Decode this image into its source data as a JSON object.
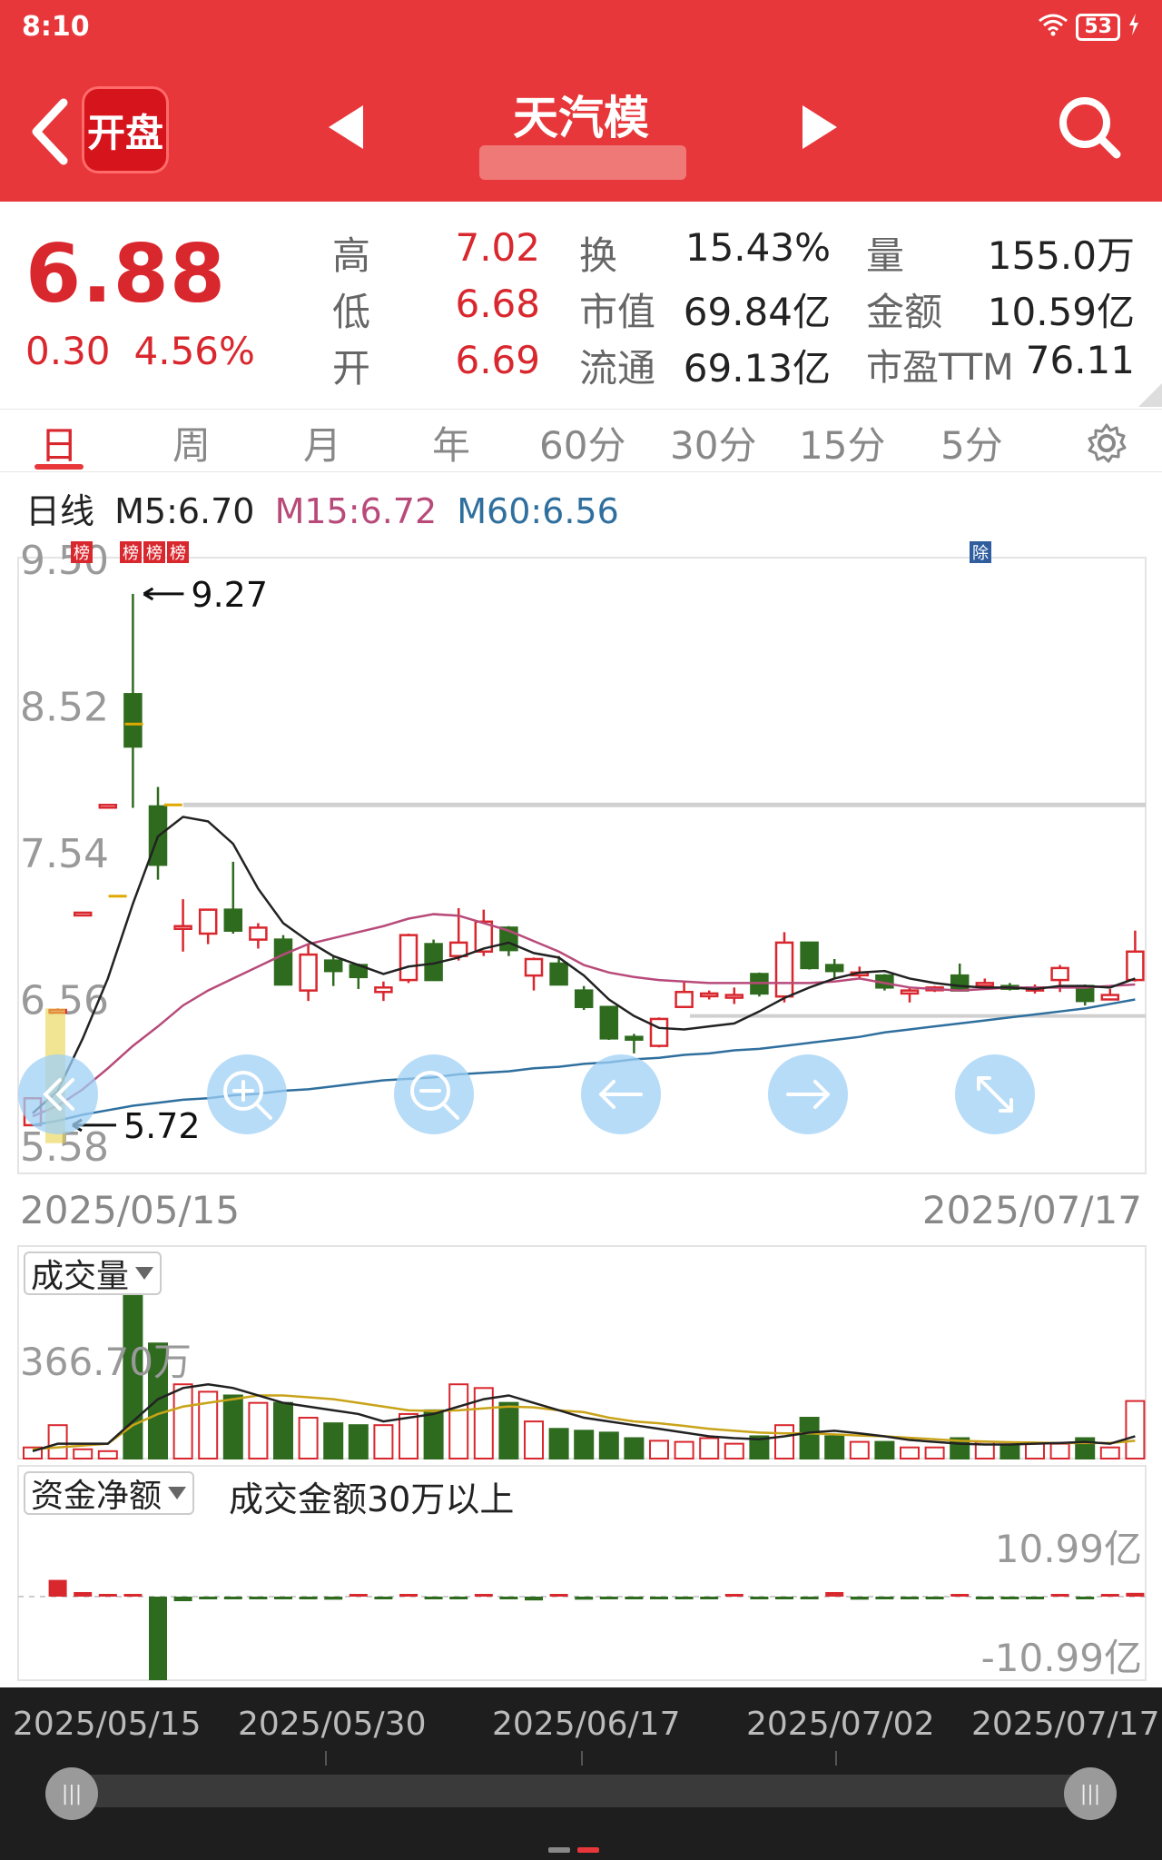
{
  "status": {
    "time": "8:10",
    "battery": "53"
  },
  "header": {
    "title": "天汽模",
    "logo_text": "开盘"
  },
  "quote": {
    "price": "6.88",
    "change": "0.30",
    "change_pct": "4.56%",
    "fields": [
      {
        "label": "高",
        "value": "7.02"
      },
      {
        "label": "低",
        "value": "6.68"
      },
      {
        "label": "开",
        "value": "6.69"
      },
      {
        "label": "换",
        "value": "15.43%"
      },
      {
        "label": "市值",
        "value": "69.84亿"
      },
      {
        "label": "流通",
        "value": "69.13亿"
      },
      {
        "label": "量",
        "value": "155.0万"
      },
      {
        "label": "金额",
        "value": "10.59亿"
      },
      {
        "label": "市盈TTM",
        "value": "76.11"
      }
    ]
  },
  "tabs": [
    "日",
    "周",
    "月",
    "年",
    "60分",
    "30分",
    "15分",
    "5分"
  ],
  "ma": {
    "title": "日线",
    "m5": "M5:6.70",
    "m15": "M15:6.72",
    "m60": "M60:6.56"
  },
  "colors": {
    "up": "#d9272e",
    "down": "#2f6b1f",
    "m5": "#222222",
    "m15": "#b84a7a",
    "m60": "#2f6f9e",
    "vol_ma": "#c9a318"
  },
  "markers": {
    "bang": "榜",
    "chu": "除"
  },
  "chart_data": {
    "type": "candlestick",
    "y_axis_labels": [
      "9.50",
      "8.52",
      "7.54",
      "6.56",
      "5.58"
    ],
    "ylim": [
      5.58,
      9.5
    ],
    "high_label": "9.27",
    "low_label": "5.72",
    "candles": [
      {
        "o": 5.72,
        "h": 5.9,
        "l": 5.72,
        "c": 5.9,
        "v": 30
      },
      {
        "o": 6.48,
        "h": 6.5,
        "l": 6.48,
        "c": 6.49,
        "v": 90
      },
      {
        "o": 7.13,
        "h": 7.14,
        "l": 7.13,
        "c": 7.14,
        "v": 25
      },
      {
        "o": 7.85,
        "h": 7.86,
        "l": 7.85,
        "c": 7.86,
        "v": 20
      },
      {
        "o": 8.6,
        "h": 9.27,
        "l": 7.84,
        "c": 8.25,
        "v": 450
      },
      {
        "o": 7.85,
        "h": 7.98,
        "l": 7.36,
        "c": 7.46,
        "v": 310
      },
      {
        "o": 7.05,
        "h": 7.23,
        "l": 6.88,
        "c": 7.05,
        "v": 200
      },
      {
        "o": 7.0,
        "h": 7.13,
        "l": 6.93,
        "c": 7.16,
        "v": 180
      },
      {
        "o": 7.16,
        "h": 7.48,
        "l": 7.0,
        "c": 7.02,
        "v": 170
      },
      {
        "o": 6.96,
        "h": 7.07,
        "l": 6.9,
        "c": 7.04,
        "v": 150
      },
      {
        "o": 6.96,
        "h": 6.99,
        "l": 6.66,
        "c": 6.66,
        "v": 150
      },
      {
        "o": 6.62,
        "h": 6.93,
        "l": 6.55,
        "c": 6.86,
        "v": 110
      },
      {
        "o": 6.82,
        "h": 6.85,
        "l": 6.65,
        "c": 6.75,
        "v": 95
      },
      {
        "o": 6.79,
        "h": 6.8,
        "l": 6.63,
        "c": 6.71,
        "v": 90
      },
      {
        "o": 6.61,
        "h": 6.68,
        "l": 6.55,
        "c": 6.64,
        "v": 90
      },
      {
        "o": 6.69,
        "h": 7.0,
        "l": 6.67,
        "c": 6.99,
        "v": 120
      },
      {
        "o": 6.93,
        "h": 6.96,
        "l": 6.69,
        "c": 6.69,
        "v": 130
      },
      {
        "o": 6.85,
        "h": 7.17,
        "l": 6.82,
        "c": 6.94,
        "v": 200
      },
      {
        "o": 6.88,
        "h": 7.16,
        "l": 6.85,
        "c": 7.08,
        "v": 190
      },
      {
        "o": 7.04,
        "h": 7.05,
        "l": 6.85,
        "c": 6.89,
        "v": 150
      },
      {
        "o": 6.72,
        "h": 6.84,
        "l": 6.62,
        "c": 6.83,
        "v": 100
      },
      {
        "o": 6.8,
        "h": 6.85,
        "l": 6.67,
        "c": 6.66,
        "v": 80
      },
      {
        "o": 6.62,
        "h": 6.65,
        "l": 6.49,
        "c": 6.51,
        "v": 75
      },
      {
        "o": 6.51,
        "h": 6.51,
        "l": 6.29,
        "c": 6.3,
        "v": 70
      },
      {
        "o": 6.31,
        "h": 6.33,
        "l": 6.2,
        "c": 6.3,
        "v": 55
      },
      {
        "o": 6.25,
        "h": 6.44,
        "l": 6.24,
        "c": 6.43,
        "v": 48
      },
      {
        "o": 6.51,
        "h": 6.68,
        "l": 6.52,
        "c": 6.61,
        "v": 45
      },
      {
        "o": 6.6,
        "h": 6.62,
        "l": 6.56,
        "c": 6.6,
        "v": 55
      },
      {
        "o": 6.59,
        "h": 6.64,
        "l": 6.53,
        "c": 6.59,
        "v": 40
      },
      {
        "o": 6.73,
        "h": 6.74,
        "l": 6.58,
        "c": 6.6,
        "v": 60
      },
      {
        "o": 6.58,
        "h": 7.01,
        "l": 6.54,
        "c": 6.94,
        "v": 90
      },
      {
        "o": 6.94,
        "h": 6.94,
        "l": 6.76,
        "c": 6.77,
        "v": 110
      },
      {
        "o": 6.79,
        "h": 6.83,
        "l": 6.7,
        "c": 6.75,
        "v": 60
      },
      {
        "o": 6.73,
        "h": 6.78,
        "l": 6.7,
        "c": 6.74,
        "v": 45
      },
      {
        "o": 6.72,
        "h": 6.73,
        "l": 6.62,
        "c": 6.64,
        "v": 45
      },
      {
        "o": 6.6,
        "h": 6.64,
        "l": 6.54,
        "c": 6.62,
        "v": 30
      },
      {
        "o": 6.63,
        "h": 6.65,
        "l": 6.61,
        "c": 6.64,
        "v": 30
      },
      {
        "o": 6.72,
        "h": 6.8,
        "l": 6.62,
        "c": 6.62,
        "v": 55
      },
      {
        "o": 6.67,
        "h": 6.7,
        "l": 6.64,
        "c": 6.67,
        "v": 45
      },
      {
        "o": 6.65,
        "h": 6.67,
        "l": 6.62,
        "c": 6.64,
        "v": 35
      },
      {
        "o": 6.62,
        "h": 6.66,
        "l": 6.6,
        "c": 6.64,
        "v": 40
      },
      {
        "o": 6.69,
        "h": 6.79,
        "l": 6.61,
        "c": 6.77,
        "v": 40
      },
      {
        "o": 6.65,
        "h": 6.66,
        "l": 6.52,
        "c": 6.55,
        "v": 55
      },
      {
        "o": 6.56,
        "h": 6.63,
        "l": 6.56,
        "c": 6.59,
        "v": 30
      },
      {
        "o": 6.69,
        "h": 7.02,
        "l": 6.68,
        "c": 6.88,
        "v": 155
      }
    ],
    "ma5": [
      5.8,
      5.95,
      6.3,
      6.7,
      7.2,
      7.65,
      7.78,
      7.75,
      7.6,
      7.3,
      7.07,
      6.95,
      6.85,
      6.79,
      6.73,
      6.78,
      6.8,
      6.84,
      6.9,
      6.94,
      6.87,
      6.84,
      6.72,
      6.56,
      6.45,
      6.37,
      6.36,
      6.38,
      6.4,
      6.48,
      6.57,
      6.64,
      6.7,
      6.74,
      6.75,
      6.7,
      6.67,
      6.65,
      6.64,
      6.64,
      6.63,
      6.65,
      6.65,
      6.64,
      6.7
    ],
    "ma15": [
      5.78,
      5.85,
      5.96,
      6.1,
      6.25,
      6.38,
      6.52,
      6.62,
      6.7,
      6.78,
      6.86,
      6.93,
      6.97,
      7.01,
      7.05,
      7.1,
      7.13,
      7.12,
      7.07,
      7.02,
      6.95,
      6.88,
      6.79,
      6.74,
      6.71,
      6.69,
      6.68,
      6.67,
      6.67,
      6.67,
      6.67,
      6.67,
      6.68,
      6.7,
      6.67,
      6.64,
      6.63,
      6.62,
      6.63,
      6.64,
      6.64,
      6.64,
      6.64,
      6.65,
      6.66
    ],
    "ma60": [
      5.72,
      5.75,
      5.79,
      5.82,
      5.85,
      5.87,
      5.89,
      5.9,
      5.92,
      5.93,
      5.95,
      5.96,
      5.98,
      6.0,
      6.02,
      6.03,
      6.04,
      6.06,
      6.07,
      6.08,
      6.1,
      6.11,
      6.13,
      6.14,
      6.16,
      6.17,
      6.19,
      6.2,
      6.22,
      6.23,
      6.25,
      6.27,
      6.29,
      6.31,
      6.34,
      6.36,
      6.38,
      6.4,
      6.42,
      6.44,
      6.46,
      6.48,
      6.5,
      6.53,
      6.56
    ],
    "volume_axis_label": "366.70万",
    "volume_ma5": [
      20,
      40,
      40,
      40,
      100,
      160,
      190,
      200,
      190,
      170,
      150,
      140,
      130,
      120,
      100,
      110,
      120,
      140,
      160,
      170,
      150,
      130,
      110,
      100,
      90,
      80,
      70,
      60,
      55,
      52,
      60,
      70,
      75,
      68,
      60,
      50,
      45,
      40,
      38,
      38,
      40,
      42,
      45,
      40,
      60
    ],
    "volume_ma10": [
      25,
      30,
      35,
      40,
      90,
      120,
      140,
      150,
      160,
      170,
      170,
      165,
      160,
      150,
      140,
      130,
      128,
      130,
      135,
      140,
      138,
      130,
      125,
      110,
      100,
      95,
      88,
      80,
      75,
      70,
      68,
      68,
      65,
      62,
      60,
      56,
      52,
      48,
      46,
      44,
      43,
      42,
      42,
      42,
      48
    ],
    "net_flow_max": "10.99亿",
    "net_flow_min": "-10.99亿",
    "net_flow": [
      0,
      2.2,
      0.6,
      0.2,
      0.3,
      -10.99,
      -0.6,
      -0.3,
      -0.3,
      -0.2,
      -0.2,
      -0.2,
      -0.4,
      0.2,
      -0.2,
      0.2,
      -0.1,
      -0.3,
      0.2,
      -0.2,
      -0.5,
      0.2,
      -0.4,
      -0.1,
      -0.1,
      -0.1,
      -0.2,
      -0.1,
      0.1,
      -0.2,
      -0.1,
      -0.2,
      0.6,
      -0.4,
      -0.2,
      -0.2,
      -0.1,
      0.1,
      -0.2,
      -0.1,
      -0.1,
      0.2,
      -0.3,
      0.1,
      0.5
    ]
  },
  "dates": {
    "start": "2025/05/15",
    "end": "2025/07/17"
  },
  "panels": {
    "volume_label": "成交量",
    "flow_label": "资金净额",
    "flow_note": "成交金额30万以上"
  },
  "scroller": {
    "dates": [
      "2025/05/15",
      "2025/05/30",
      "2025/06/17",
      "2025/07/02",
      "2025/07/17"
    ]
  }
}
